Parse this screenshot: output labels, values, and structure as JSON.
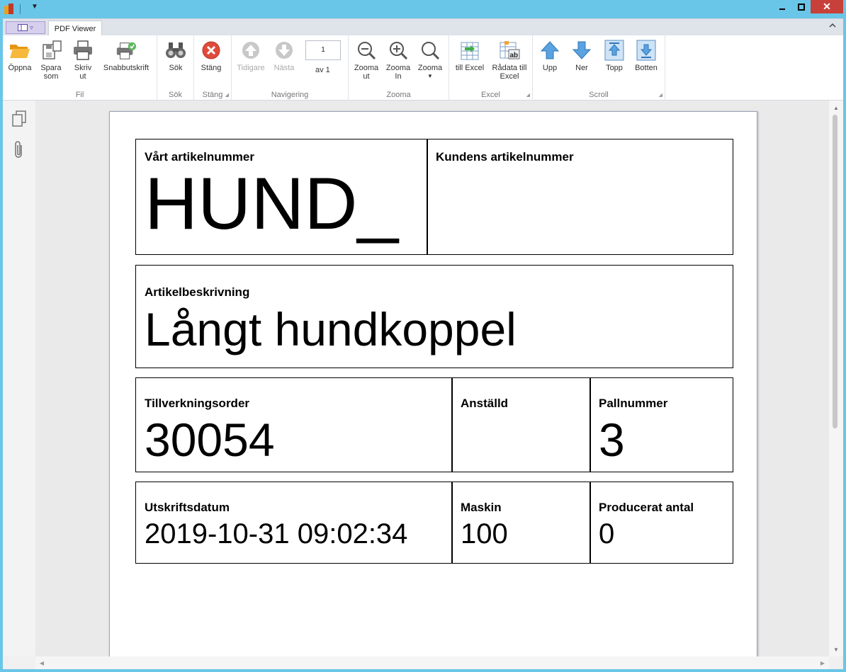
{
  "tabs": {
    "pdf_viewer": "PDF Viewer"
  },
  "ribbon": {
    "groups": {
      "fil": "Fil",
      "sok": "Sök",
      "stang": "Stäng",
      "navigering": "Navigering",
      "zooma": "Zooma",
      "excel": "Excel",
      "scroll": "Scroll"
    },
    "buttons": {
      "oppna": "Öppna",
      "spara_l1": "Spara",
      "spara_l2": "som",
      "skriv_l1": "Skriv",
      "skriv_l2": "ut",
      "snabb": "Snabbutskrift",
      "sok": "Sök",
      "stang": "Stäng",
      "tidigare": "Tidigare",
      "nasta": "Nästa",
      "zooma_ut_l1": "Zooma",
      "zooma_ut_l2": "ut",
      "zooma_in_l1": "Zooma",
      "zooma_in_l2": "In",
      "zooma": "Zooma",
      "till_excel": "till Excel",
      "radata_l1": "Rådata till",
      "radata_l2": "Excel",
      "upp": "Upp",
      "ner": "Ner",
      "topp": "Topp",
      "botten": "Botten"
    },
    "navigation": {
      "page": "1",
      "of_label": "av 1"
    }
  },
  "document": {
    "vart_artikelnummer": {
      "label": "Vårt artikelnummer",
      "value": "HUND_"
    },
    "kundens_artikelnummer": {
      "label": "Kundens artikelnummer",
      "value": ""
    },
    "artikelbeskrivning": {
      "label": "Artikelbeskrivning",
      "value": "Långt hundkoppel"
    },
    "tillverkningsorder": {
      "label": "Tillverkningsorder",
      "value": "30054"
    },
    "anstalld": {
      "label": "Anställd",
      "value": ""
    },
    "pallnummer": {
      "label": "Pallnummer",
      "value": "3"
    },
    "utskriftsdatum": {
      "label": "Utskriftsdatum",
      "value": "2019-10-31 09:02:34"
    },
    "maskin": {
      "label": "Maskin",
      "value": "100"
    },
    "producerat_antal": {
      "label": "Producerat antal",
      "value": "0"
    }
  },
  "colors": {
    "titlebar": "#6ac6e8",
    "close_button": "#c7403a",
    "accent_blue": "#4a8fd6",
    "folder_orange": "#f3a52b"
  }
}
